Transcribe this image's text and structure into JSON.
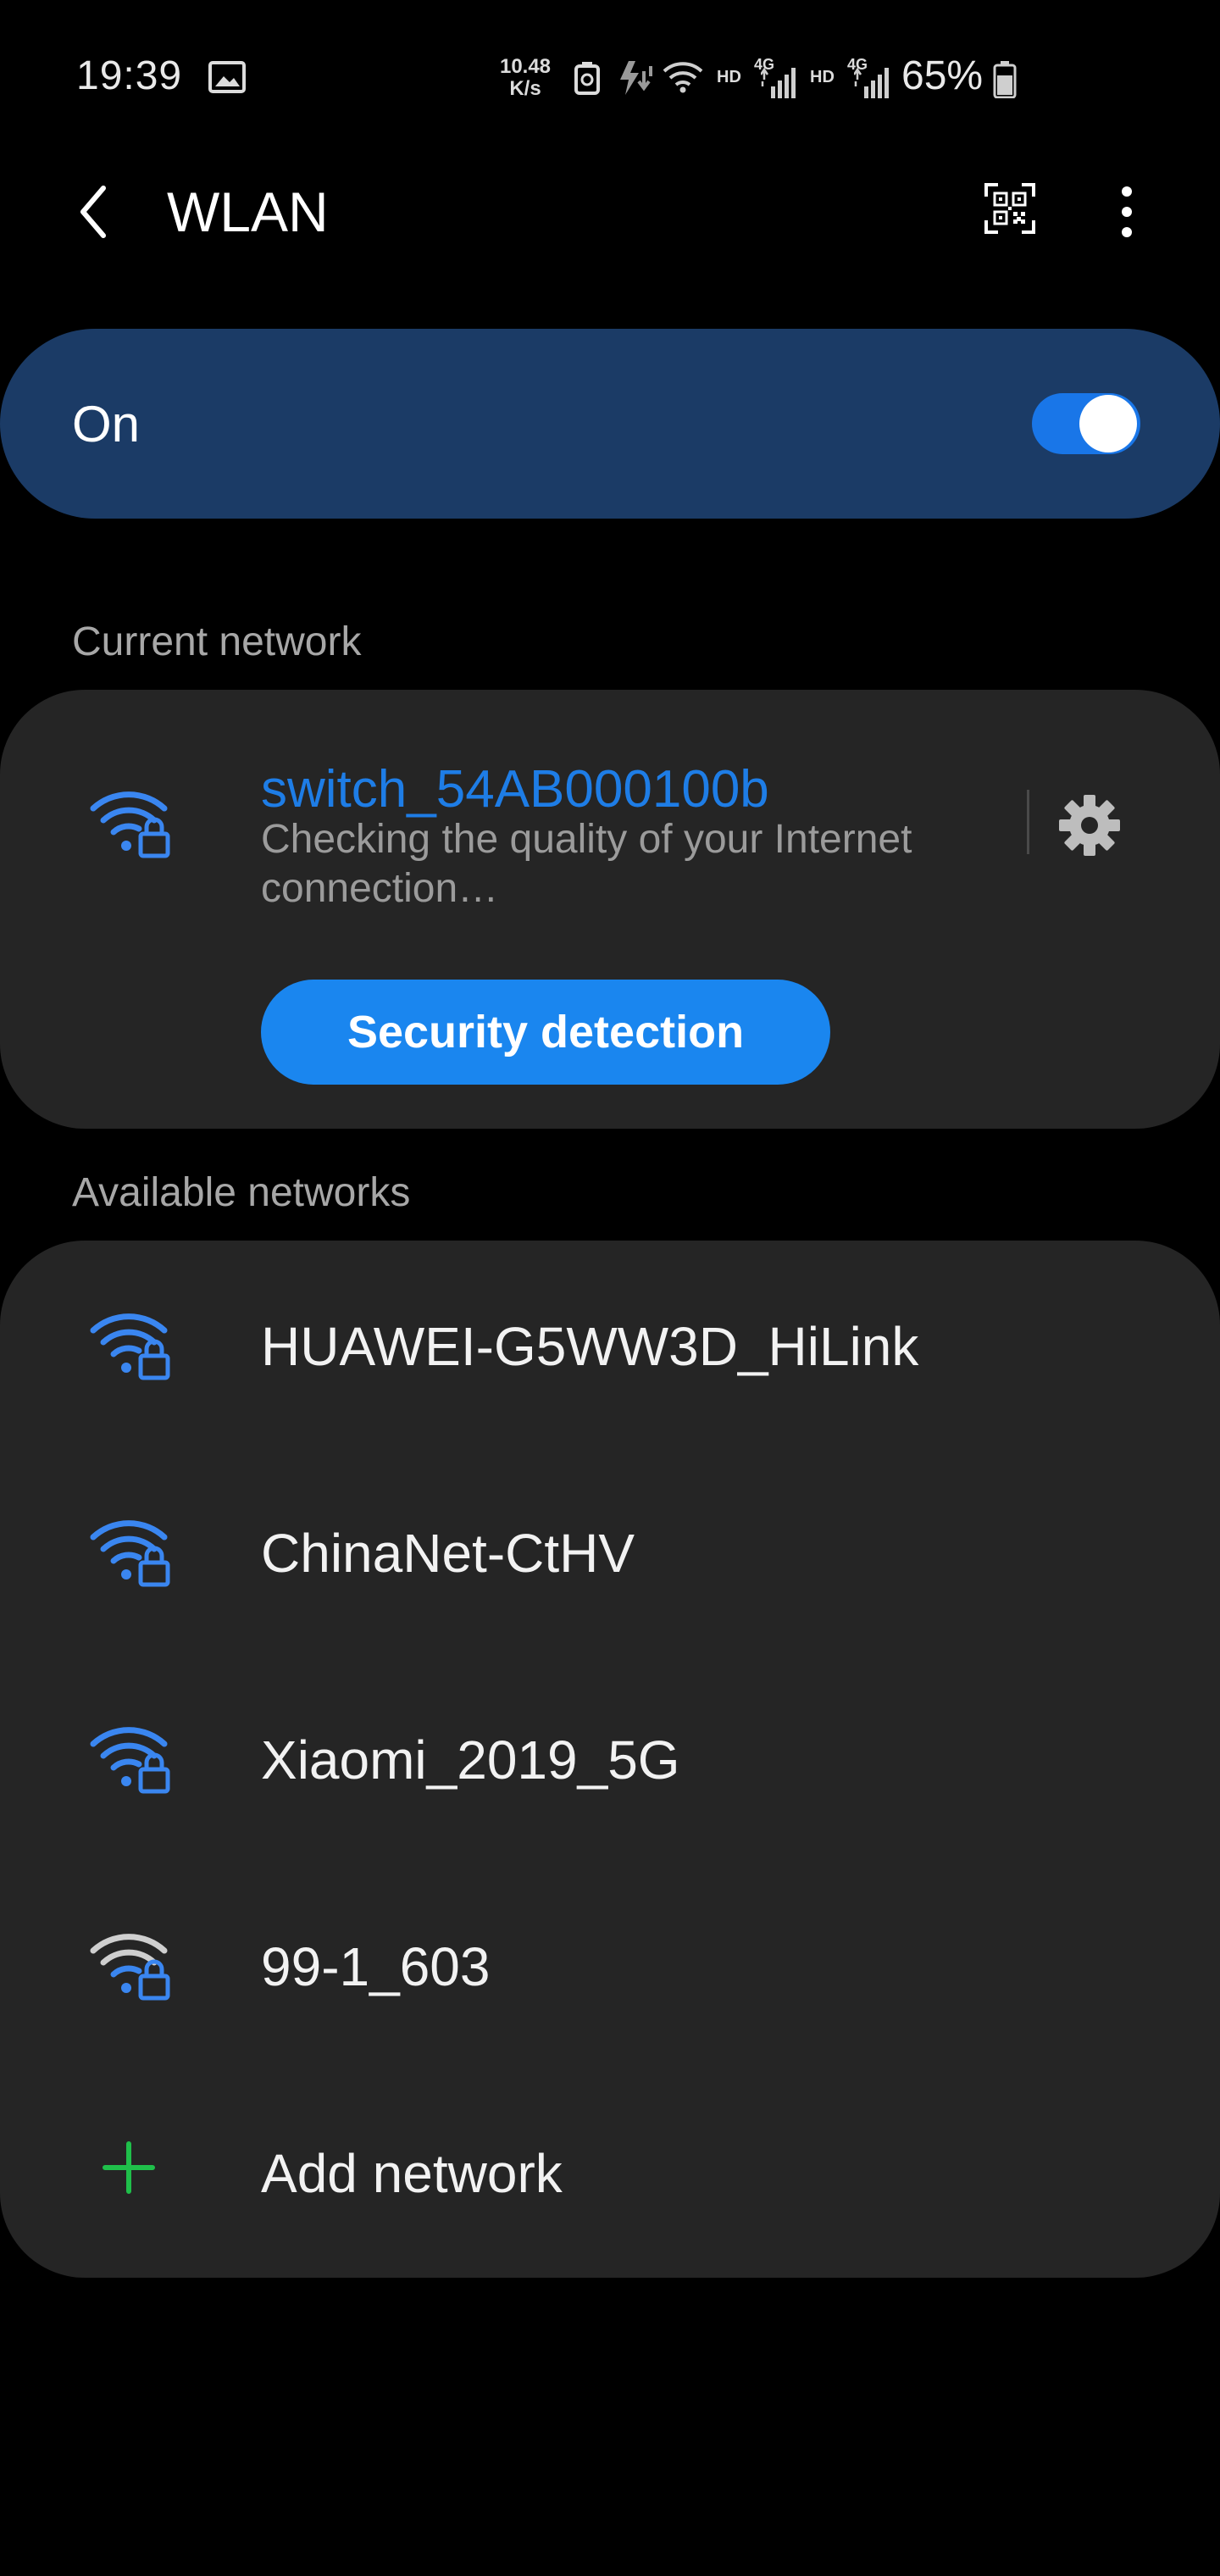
{
  "status_bar": {
    "time": "19:39",
    "speed_value": "10.48",
    "speed_unit": "K/s",
    "hd1": "HD",
    "net1": "4G",
    "hd2": "HD",
    "net2": "4G",
    "battery": "65%"
  },
  "app_bar": {
    "title": "WLAN"
  },
  "master_switch": {
    "label": "On",
    "state": "on"
  },
  "current_network": {
    "header": "Current network",
    "ssid": "switch_54AB000100b",
    "status": "Checking the quality of your Internet connection…",
    "button_label": "Security detection"
  },
  "available_networks": {
    "header": "Available networks",
    "items": [
      {
        "ssid": "HUAWEI-G5WW3D_HiLink",
        "icon": "wifi-lock-icon",
        "color": "#3a86f0"
      },
      {
        "ssid": "ChinaNet-CtHV",
        "icon": "wifi-lock-icon",
        "color": "#3a86f0"
      },
      {
        "ssid": "Xiaomi_2019_5G",
        "icon": "wifi-lock-icon",
        "color": "#3a86f0"
      },
      {
        "ssid": "99-1_603",
        "icon": "wifi-lock-icon",
        "color": "#cfcfcf"
      }
    ],
    "add_label": "Add network"
  },
  "colors": {
    "accent": "#1e7de6",
    "switch_card": "#1b3b66",
    "card": "#252525",
    "add_plus": "#1fbf4a"
  }
}
